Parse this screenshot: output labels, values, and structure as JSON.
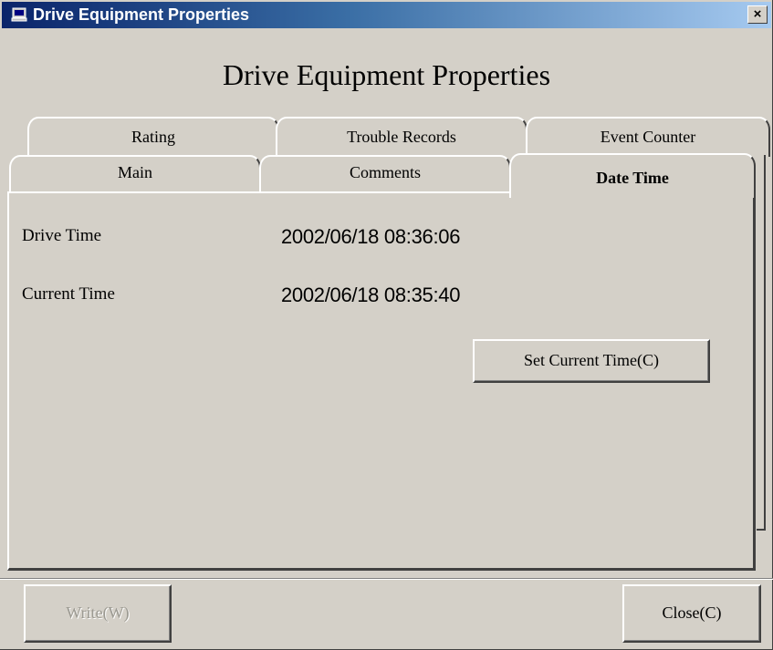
{
  "window": {
    "title": "Drive Equipment Properties",
    "close_glyph": "×",
    "title_icon": "computer-icon"
  },
  "heading": "Drive Equipment Properties",
  "tabs": {
    "back_row": [
      "Rating",
      "Trouble Records",
      "Event Counter"
    ],
    "front_row": [
      "Main",
      "Comments",
      "Date Time"
    ],
    "active": "Date Time"
  },
  "date_time": {
    "drive_time_label": "Drive Time",
    "drive_time_value": "2002/06/18 08:36:06",
    "current_time_label": "Current Time",
    "current_time_value": "2002/06/18 08:35:40",
    "set_current_time_button": "Set Current Time(C)"
  },
  "footer": {
    "write_button": "Write(W)",
    "close_button": "Close(C)"
  },
  "colors": {
    "title_gradient_start": "#0a246a",
    "title_gradient_end": "#a6caf0",
    "face": "#d4d0c8"
  }
}
